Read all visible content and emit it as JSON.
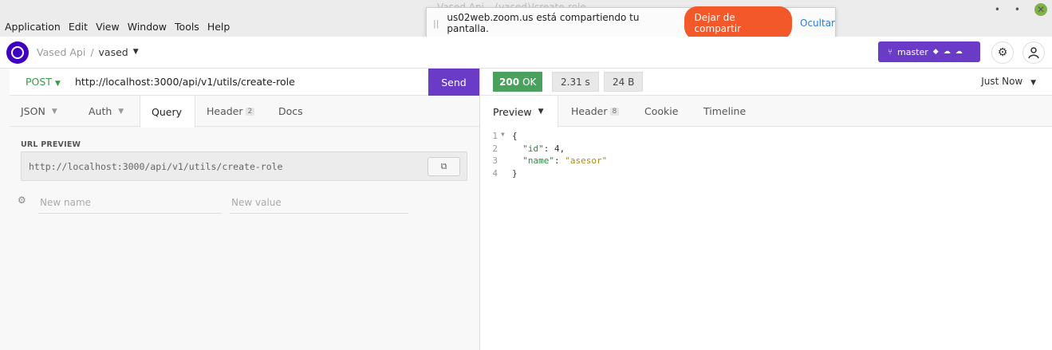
{
  "os_menu": [
    "Application",
    "Edit",
    "View",
    "Window",
    "Tools",
    "Help"
  ],
  "window_controls": {
    "minimize": "•",
    "restore": "•",
    "close": "✕"
  },
  "faded_title": "Vased Api – (vased)/create-role",
  "zoom": {
    "message": "us02web.zoom.us está compartiendo tu pantalla.",
    "stop_label": "Dejar de compartir",
    "hide_label": "Ocultar"
  },
  "header": {
    "workspace": "Vased Api",
    "separator": "/",
    "project": "vased",
    "branch_label": "master"
  },
  "request": {
    "method": "POST",
    "url": "http://localhost:3000/api/v1/utils/create-role",
    "send_label": "Send",
    "tabs": [
      {
        "label": "JSON",
        "dropdown": true
      },
      {
        "label": "Auth",
        "dropdown": true
      },
      {
        "label": "Query",
        "active": true
      },
      {
        "label": "Header",
        "badge": "2"
      },
      {
        "label": "Docs"
      }
    ],
    "url_preview_label": "URL PREVIEW",
    "url_preview_value": "http://localhost:3000/api/v1/utils/create-role",
    "param_name_placeholder": "New name",
    "param_value_placeholder": "New value"
  },
  "response": {
    "status_code": "200",
    "status_text": "OK",
    "time": "2.31 s",
    "size": "24 B",
    "timestamp": "Just Now",
    "tabs": [
      {
        "label": "Preview",
        "active": true,
        "dropdown": true
      },
      {
        "label": "Header",
        "badge": "8"
      },
      {
        "label": "Cookie"
      },
      {
        "label": "Timeline"
      }
    ],
    "body_lines": [
      {
        "num": "1",
        "fold": "▼",
        "text": "{"
      },
      {
        "num": "2",
        "key": "\"id\"",
        "value": "4",
        "type": "number",
        "suffix": ","
      },
      {
        "num": "3",
        "key": "\"name\"",
        "value": "\"asesor\"",
        "type": "string",
        "suffix": ""
      },
      {
        "num": "4",
        "text": "}"
      }
    ]
  },
  "colors": {
    "accent": "#6a3bc6",
    "status_ok": "#4aa05d",
    "zoom_stop": "#f3582b",
    "json_key": "#2a8b40",
    "json_string": "#b3861a"
  }
}
